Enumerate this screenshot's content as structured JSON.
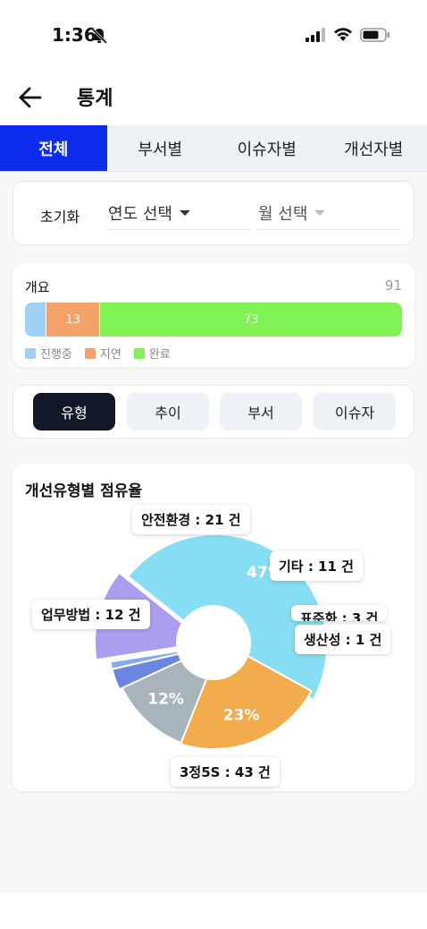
{
  "status_bar": {
    "time": "1:36"
  },
  "header": {
    "title": "통계"
  },
  "tabs": [
    {
      "label": "전체",
      "active": true
    },
    {
      "label": "부서별",
      "active": false
    },
    {
      "label": "이슈자별",
      "active": false
    },
    {
      "label": "개선자별",
      "active": false
    }
  ],
  "filter": {
    "reset_label": "초기화",
    "year_select": "연도 선택",
    "month_select": "월 선택"
  },
  "overview": {
    "label": "개요",
    "total": "91",
    "segments": [
      {
        "name": "진행중",
        "value": 5,
        "color": "#9fd0f5",
        "label": ""
      },
      {
        "name": "지연",
        "value": 13,
        "color": "#f3a26a",
        "label": "13"
      },
      {
        "name": "완료",
        "value": 73,
        "color": "#7ff353",
        "label": "73"
      }
    ],
    "legend": [
      "진행중",
      "지연",
      "완료"
    ]
  },
  "view_buttons": [
    {
      "label": "유형",
      "active": true
    },
    {
      "label": "추이",
      "active": false
    },
    {
      "label": "부서",
      "active": false
    },
    {
      "label": "이슈자",
      "active": false
    }
  ],
  "chart_title": "개선유형별 점유율",
  "chart_data": {
    "type": "pie",
    "title": "개선유형별 점유율",
    "categories": [
      "3정5S",
      "안전환경",
      "기타",
      "표준화",
      "생산성",
      "업무방법"
    ],
    "values": [
      43,
      21,
      11,
      3,
      1,
      12
    ],
    "percent_labels": [
      "47%",
      "23%",
      "12%",
      "",
      "",
      "%"
    ],
    "colors": [
      "#85def3",
      "#f2ac4b",
      "#a8b4bc",
      "#6b86e0",
      "#8aaaf0",
      "#ad9df0"
    ],
    "callouts": [
      "3정5S : 43 건",
      "안전환경 : 21 건",
      "기타 : 11 건",
      "표준화 : 3 건",
      "생산성 : 1 건",
      "업무방법 : 12 건"
    ]
  },
  "callouts_visible": {
    "c0": "3정5S : 43 건",
    "c1": "안전환경 : 21 건",
    "c2": "기타 : 11 건",
    "c3": "표준화 : 3 건",
    "c4": "생산성 : 1 건",
    "c5": "업무방법 : 12 건"
  }
}
